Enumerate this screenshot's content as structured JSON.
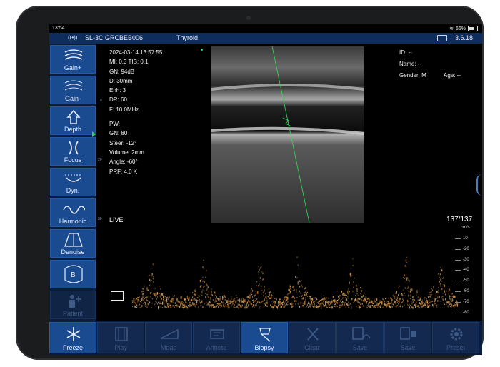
{
  "status_bar": {
    "time": "13:54",
    "battery": "66%"
  },
  "header": {
    "device": "SL-3C GRCBEB006",
    "preset": "Thyroid",
    "version": "3.6.18"
  },
  "left_toolbar": [
    {
      "label": "Gain+",
      "icon": "gain-up-icon",
      "enabled": true
    },
    {
      "label": "Gain-",
      "icon": "gain-down-icon",
      "enabled": true
    },
    {
      "label": "Depth",
      "icon": "depth-icon",
      "enabled": true
    },
    {
      "label": "Focus",
      "icon": "focus-icon",
      "enabled": true
    },
    {
      "label": "Dyn.",
      "icon": "dynamic-range-icon",
      "enabled": true
    },
    {
      "label": "Harmonic",
      "icon": "harmonic-icon",
      "enabled": true
    },
    {
      "label": "Denoise",
      "icon": "denoise-icon",
      "enabled": true
    },
    {
      "label": "",
      "icon": "b-mode-icon",
      "enabled": true
    },
    {
      "label": "Patient",
      "icon": "patient-icon",
      "enabled": false
    }
  ],
  "params": {
    "datetime": "2024-03-14 13:57:55",
    "mi_tis": "MI: 0.3  TIS: 0.1",
    "gn": "GN: 94dB",
    "d": "D: 30mm",
    "enh": "Enh: 3",
    "dr": "DR: 60",
    "f": "F: 10.0MHz",
    "pw": "PW:",
    "pw_gn": "GN: 80",
    "steer": "Steer: -12°",
    "volume": "Volume: 2mm",
    "angle": "Angle: -60°",
    "prf": "PRF: 4.0 K"
  },
  "patient": {
    "id": "ID: --",
    "name": "Name: --",
    "gender": "Gender: M",
    "age": "Age: --"
  },
  "live_label": "LIVE",
  "frame_count": "137/137",
  "depth_ticks": [
    "10",
    "20",
    "30"
  ],
  "doppler_scale": {
    "unit": "cm/s",
    "labels": [
      "10",
      "-20",
      "-30",
      "-40",
      "-50",
      "-60",
      "-70",
      "-80"
    ]
  },
  "bottom_toolbar": [
    {
      "label": "Freeze",
      "icon": "snowflake-icon",
      "active": true
    },
    {
      "label": "Play",
      "icon": "play-icon",
      "active": false
    },
    {
      "label": "Meas",
      "icon": "measure-icon",
      "active": false
    },
    {
      "label": "Annote",
      "icon": "annotate-icon",
      "active": false
    },
    {
      "label": "Biopsy",
      "icon": "biopsy-icon",
      "active": true
    },
    {
      "label": "Clear",
      "icon": "clear-icon",
      "active": false
    },
    {
      "label": "Save",
      "icon": "save-image-icon",
      "active": false
    },
    {
      "label": "Save",
      "icon": "save-video-icon",
      "active": false
    },
    {
      "label": "Preset",
      "icon": "gear-icon",
      "active": false
    }
  ],
  "colors": {
    "header": "#0e2c5c",
    "button_active": "#1a4a8f",
    "button_disabled": "#13294f",
    "doppler": "#e0a050",
    "needle_guide": "#33dd55"
  }
}
